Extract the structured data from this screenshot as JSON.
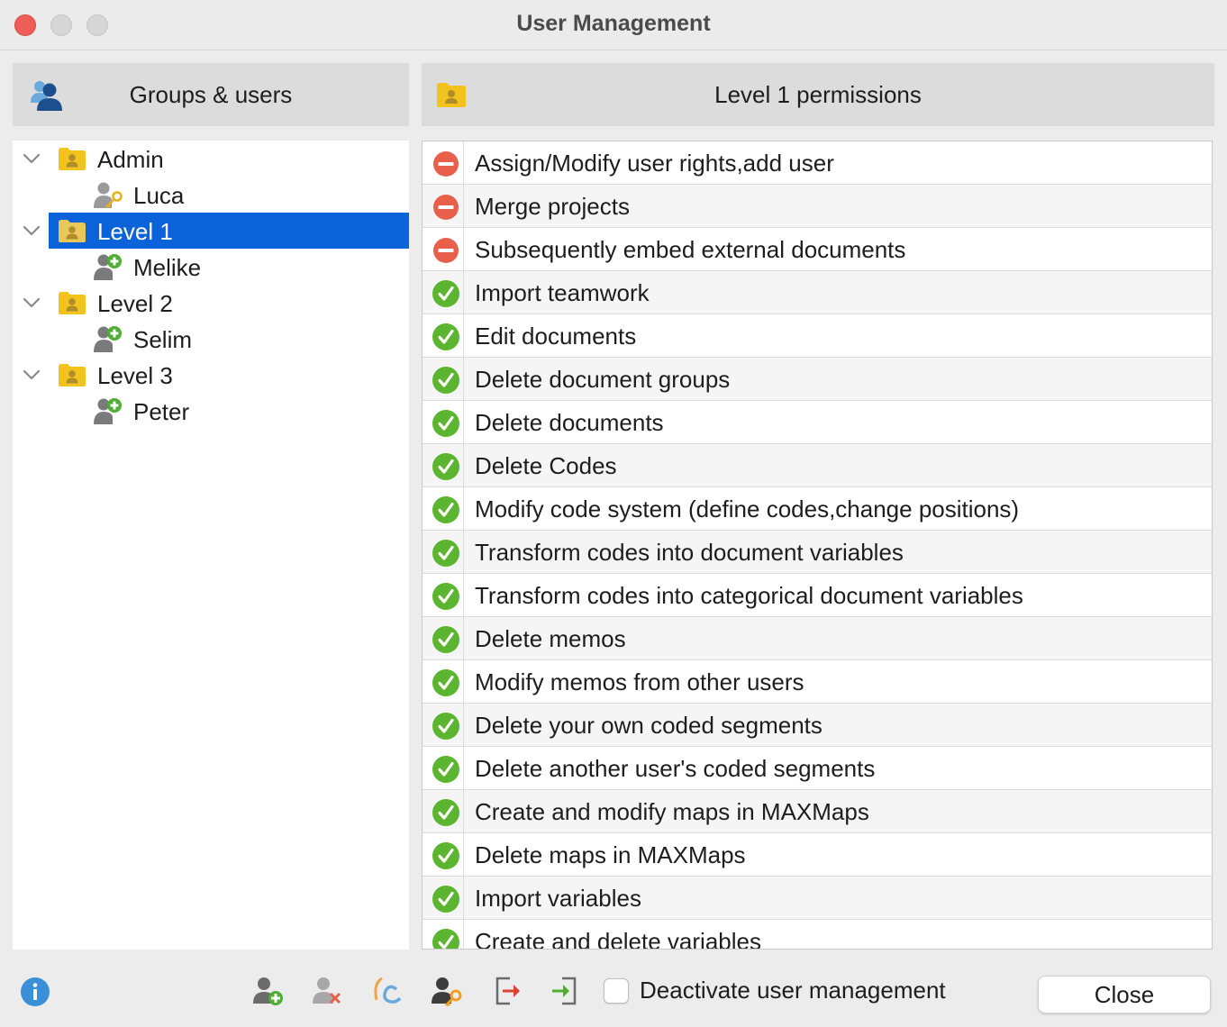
{
  "window": {
    "title": "User Management"
  },
  "left_panel": {
    "title": "Groups & users",
    "icon": "users-icon"
  },
  "right_panel": {
    "title": "Level 1 permissions",
    "icon": "group-folder-icon"
  },
  "tree": {
    "groups": [
      {
        "label": "Admin",
        "expanded": true,
        "selected": false,
        "users": [
          {
            "label": "Luca",
            "icon": "user-key-icon"
          }
        ]
      },
      {
        "label": "Level 1",
        "expanded": true,
        "selected": true,
        "users": [
          {
            "label": "Melike",
            "icon": "user-add-icon"
          }
        ]
      },
      {
        "label": "Level 2",
        "expanded": true,
        "selected": false,
        "users": [
          {
            "label": "Selim",
            "icon": "user-add-icon"
          }
        ]
      },
      {
        "label": "Level 3",
        "expanded": true,
        "selected": false,
        "users": [
          {
            "label": "Peter",
            "icon": "user-add-icon"
          }
        ]
      }
    ]
  },
  "permissions": [
    {
      "label": "Assign/Modify user rights,add user",
      "allowed": false
    },
    {
      "label": "Merge projects",
      "allowed": false
    },
    {
      "label": "Subsequently embed external documents",
      "allowed": false
    },
    {
      "label": "Import teamwork",
      "allowed": true
    },
    {
      "label": "Edit documents",
      "allowed": true
    },
    {
      "label": "Delete document groups",
      "allowed": true
    },
    {
      "label": "Delete documents",
      "allowed": true
    },
    {
      "label": "Delete Codes",
      "allowed": true
    },
    {
      "label": "Modify code system (define codes,change positions)",
      "allowed": true
    },
    {
      "label": "Transform codes into document variables",
      "allowed": true
    },
    {
      "label": "Transform codes into categorical document variables",
      "allowed": true
    },
    {
      "label": "Delete memos",
      "allowed": true
    },
    {
      "label": "Modify memos from other users",
      "allowed": true
    },
    {
      "label": "Delete your own coded segments",
      "allowed": true
    },
    {
      "label": "Delete another user's coded segments",
      "allowed": true
    },
    {
      "label": "Create and modify maps in MAXMaps",
      "allowed": true
    },
    {
      "label": "Delete maps in MAXMaps",
      "allowed": true
    },
    {
      "label": "Import variables",
      "allowed": true
    },
    {
      "label": "Create and delete variables",
      "allowed": true
    }
  ],
  "toolbar": {
    "buttons": [
      {
        "icon": "add-user-icon"
      },
      {
        "icon": "remove-user-icon"
      },
      {
        "icon": "rename-user-icon"
      },
      {
        "icon": "change-password-icon"
      },
      {
        "icon": "export-icon"
      },
      {
        "icon": "import-icon"
      }
    ],
    "deactivate_label": "Deactivate user management",
    "deactivate_checked": false,
    "close_label": "Close"
  },
  "colors": {
    "selection": "#0a63d8",
    "allowed": "#5cb531",
    "denied": "#e8604c",
    "folder": "#f2c31c"
  }
}
